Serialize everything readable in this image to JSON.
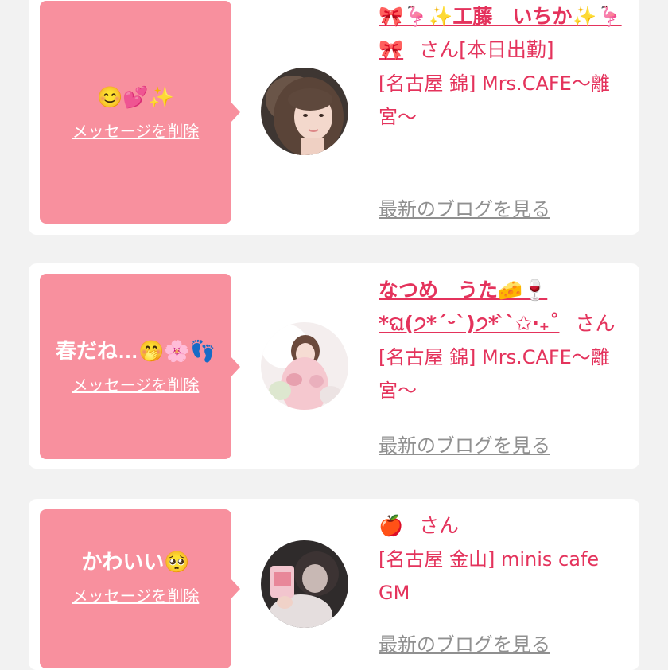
{
  "cards": [
    {
      "message": "😊💕✨",
      "delete_label": "メッセージを削除",
      "name": "🎀🦩✨工藤　いちか✨🦩🎀",
      "san": "さん",
      "status": "[本日出勤]",
      "shop": "[名古屋 錦] Mrs.CAFE〜離宮〜",
      "blog_label": "最新のブログを見る"
    },
    {
      "message": "春だね…🤭🌸👣",
      "delete_label": "メッセージを削除",
      "name": "なつめ　うた🧀🍷*ଘ(੭*ˊᵕˋ)੭* ̀ˋ✩‧₊˚",
      "san": "さん",
      "shop": "[名古屋 錦] Mrs.CAFE〜離宮〜",
      "blog_label": "最新のブログを見る"
    },
    {
      "message": "かわいい🥺",
      "delete_label": "メッセージを削除",
      "name": "🍎",
      "san": "さん",
      "shop": "[名古屋 金山] minis cafe GM",
      "blog_label": "最新のブログを見る"
    }
  ],
  "colors": {
    "accent": "#e4335c",
    "bubble": "#f8909e",
    "muted_link": "#909090",
    "background": "#f2f2f2"
  }
}
